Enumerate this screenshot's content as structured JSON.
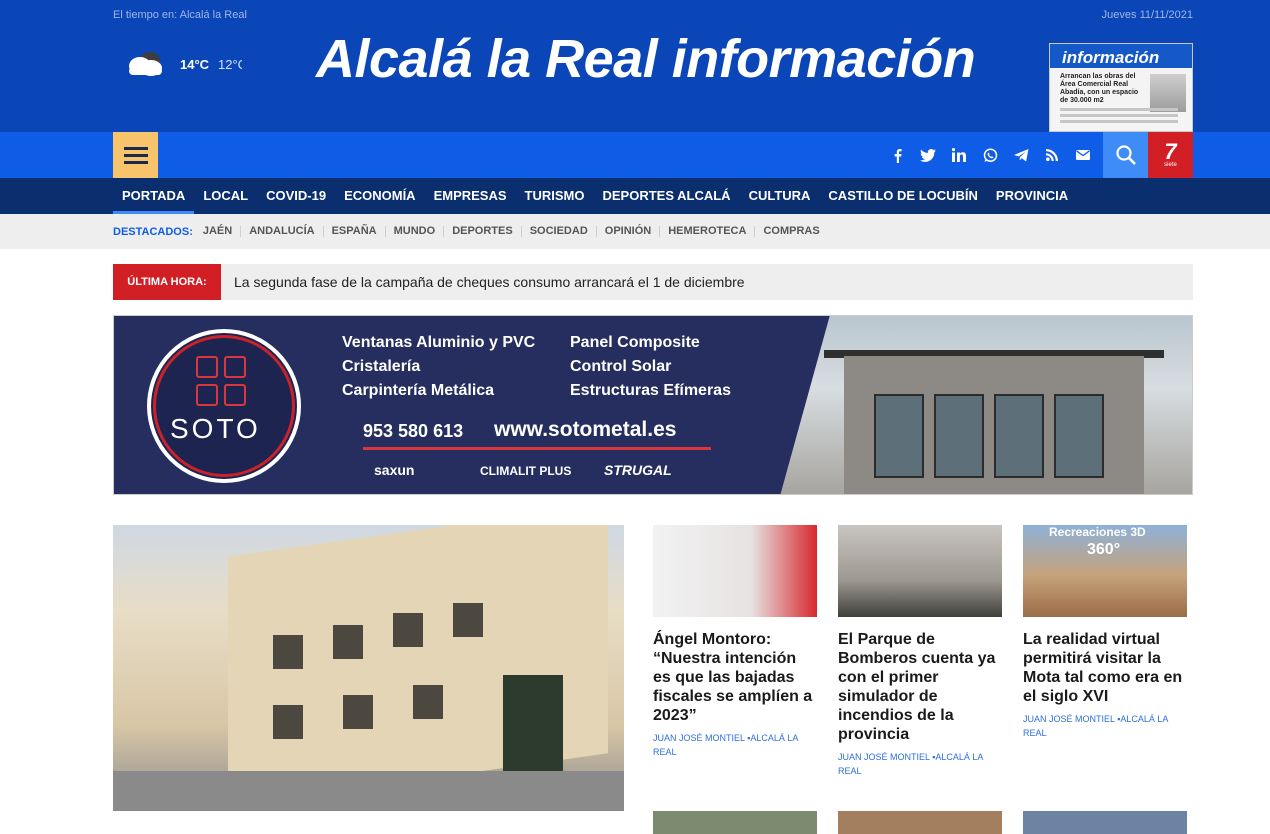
{
  "header": {
    "weather_label": "El tiempo en: Alcalá la Real",
    "temp_max": "14°C",
    "temp_min": "12°C",
    "site_title": "Alcalá la Real información",
    "date": "Jueves 11/11/2021",
    "paper": {
      "masthead": "información",
      "headline": "Arrancan las obras del Área Comercial Real Abadía, con un espacio de 30.000 m2"
    },
    "colors": {
      "brand": "#0a46b8",
      "nav": "#0f5ce6",
      "menu": "#0b2e6e",
      "accent": "#f7c46c",
      "alert": "#d21f26"
    }
  },
  "social_icons": [
    "facebook-icon",
    "twitter-icon",
    "linkedin-icon",
    "whatsapp-icon",
    "telegram-icon",
    "rss-icon",
    "email-icon"
  ],
  "menu": [
    "PORTADA",
    "LOCAL",
    "COVID-19",
    "ECONOMÍA",
    "EMPRESAS",
    "TURISMO",
    "DEPORTES ALCALÁ",
    "CULTURA",
    "CASTILLO DE LOCUBÍN",
    "PROVINCIA"
  ],
  "destacados": {
    "label": "DESTACADOS:",
    "items": [
      "JAÉN",
      "ANDALUCÍA",
      "ESPAÑA",
      "MUNDO",
      "DEPORTES",
      "SOCIEDAD",
      "OPINIÓN",
      "HEMEROTECA",
      "COMPRAS"
    ]
  },
  "ultima_hora": {
    "tag": "ÚLTIMA HORA:",
    "text": "La segunda fase de la campaña de cheques consumo arrancará el 1 de diciembre"
  },
  "banner": {
    "logo": "SOTO",
    "services_left": [
      "Ventanas Aluminio y PVC",
      "Cristalería",
      "Carpintería Metálica"
    ],
    "services_right": [
      "Panel Composite",
      "Control Solar",
      "Estructuras Efímeras"
    ],
    "phone": "953 580 613",
    "web": "www.sotometal.es",
    "brands": [
      "saxun",
      "CLIMALIT PLUS",
      "STRUGAL"
    ]
  },
  "news": [
    {
      "title": "Ángel Montoro: “Nuestra intención es que las bajadas fiscales se amplíen a 2023”",
      "author": "JUAN JOSÉ MONTIEL",
      "category": "ALCALÁ LA REAL"
    },
    {
      "title": "El Parque de Bomberos cuenta ya con el primer simulador de incendios de la provincia",
      "author": "JUAN JOSÉ MONTIEL",
      "category": "ALCALÁ LA REAL"
    },
    {
      "title": "La realidad virtual permitirá visitar la Mota tal como era en el siglo XVI",
      "author": "JUAN JOSÉ MONTIEL",
      "category": "ALCALÁ LA REAL",
      "thumb_text": "Recreaciones 3D",
      "thumb_badge": "360°"
    }
  ]
}
